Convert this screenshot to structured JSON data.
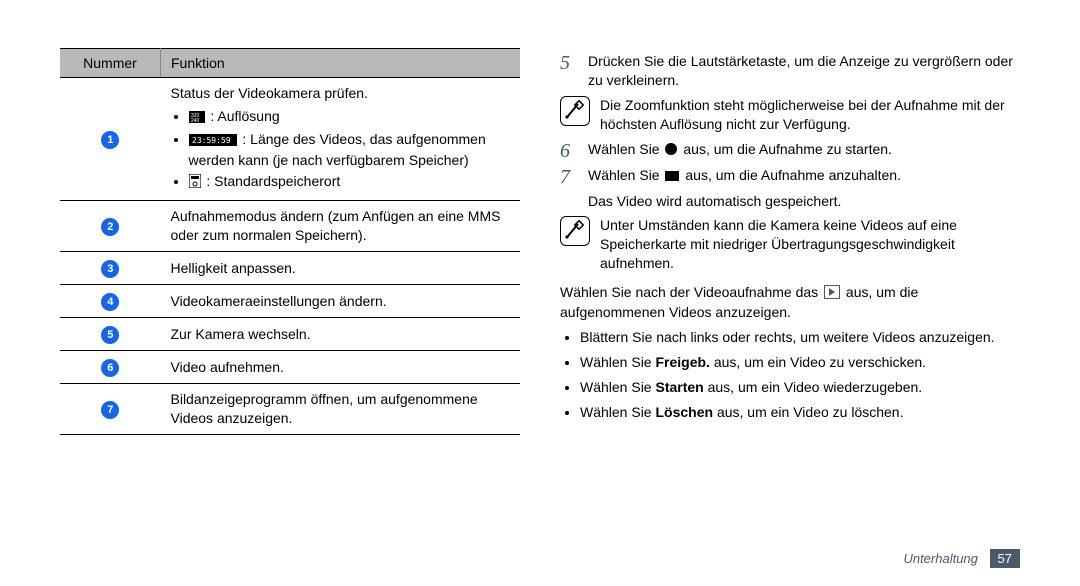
{
  "table": {
    "headers": {
      "num": "Nummer",
      "fn": "Funktion"
    },
    "rows": [
      {
        "n": "1",
        "title": "Status der Videokamera prüfen.",
        "items": [
          {
            "icon": "resolution",
            "text": " : Auflösung"
          },
          {
            "icon": "timecode",
            "text": " : Länge des Videos, das aufgenommen werden kann (je nach verfügbarem Speicher)"
          },
          {
            "icon": "storage",
            "text": " : Standardspeicherort"
          }
        ]
      },
      {
        "n": "2",
        "text": "Aufnahmemodus ändern (zum Anfügen an eine MMS oder zum normalen Speichern)."
      },
      {
        "n": "3",
        "text": "Helligkeit anpassen."
      },
      {
        "n": "4",
        "text": "Videokameraeinstellungen ändern."
      },
      {
        "n": "5",
        "text": "Zur Kamera wechseln."
      },
      {
        "n": "6",
        "text": "Video aufnehmen."
      },
      {
        "n": "7",
        "text": "Bildanzeigeprogramm öffnen, um aufgenommene Videos anzuzeigen."
      }
    ]
  },
  "steps": {
    "s5": "Drücken Sie die Lautstärketaste, um die Anzeige zu vergrößern oder zu verkleinern.",
    "note1": "Die Zoomfunktion steht möglicherweise bei der Aufnahme mit der höchsten Auflösung nicht zur Verfügung.",
    "s6_a": "Wählen Sie ",
    "s6_b": " aus, um die Aufnahme zu starten.",
    "s7_a": "Wählen Sie ",
    "s7_b": " aus, um die Aufnahme anzuhalten.",
    "after7": "Das Video wird automatisch gespeichert.",
    "note2": "Unter Umständen kann die Kamera keine Videos auf eine Speicherkarte mit niedriger Übertragungsgeschwindigkeit aufnehmen.",
    "para_a": "Wählen Sie nach der Videoaufnahme das ",
    "para_b": " aus, um die aufgenommenen Videos anzuzeigen."
  },
  "bullets": {
    "b1": "Blättern Sie nach links oder rechts, um weitere Videos anzuzeigen.",
    "b2_a": "Wählen Sie ",
    "b2_bold": "Freigeb.",
    "b2_b": " aus, um ein Video zu verschicken.",
    "b3_a": "Wählen Sie ",
    "b3_bold": "Starten",
    "b3_b": " aus, um ein Video wiederzugeben.",
    "b4_a": "Wählen Sie ",
    "b4_bold": "Löschen",
    "b4_b": " aus, um ein Video zu löschen."
  },
  "footer": {
    "section": "Unterhaltung",
    "page": "57"
  }
}
